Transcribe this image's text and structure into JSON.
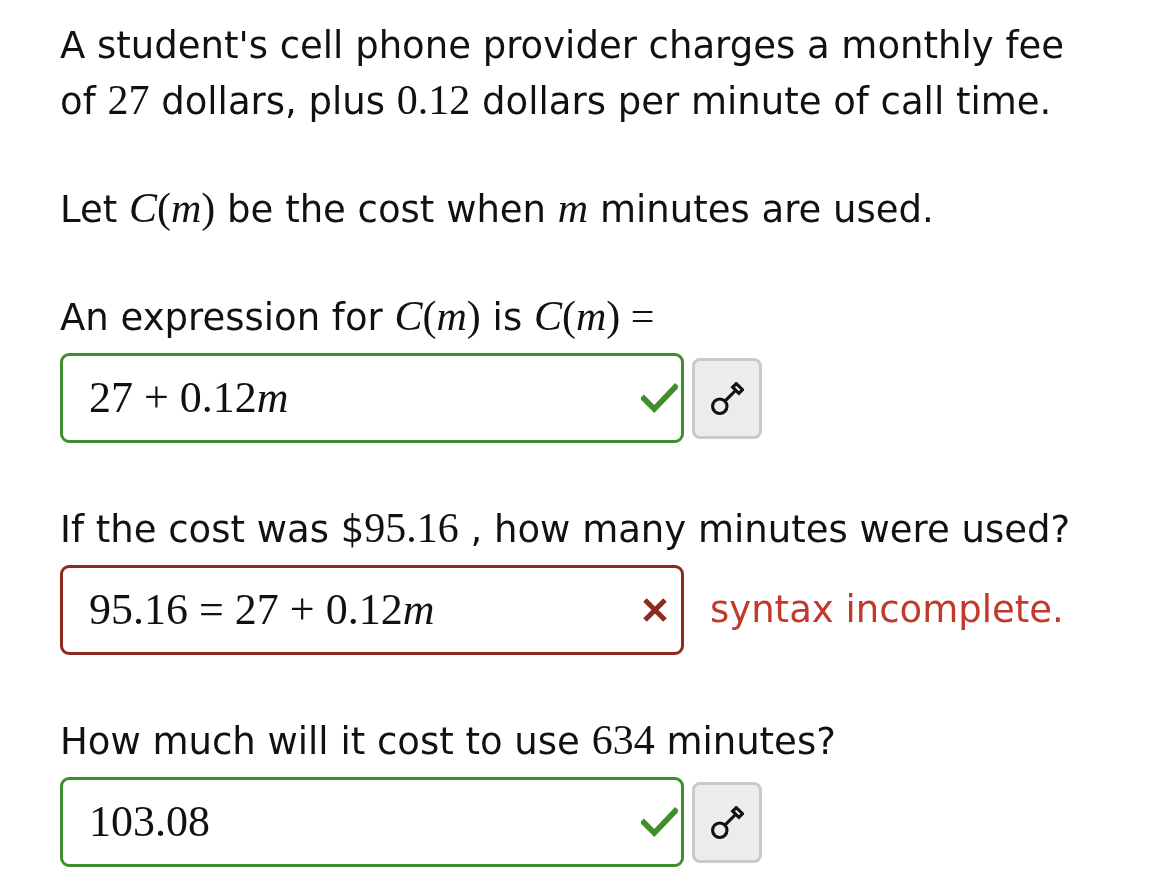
{
  "statement": [
    {
      "parts": [
        {
          "kind": "text",
          "text": "A student's cell phone provider charges a monthly fee of "
        },
        {
          "kind": "math",
          "text": "27"
        },
        {
          "kind": "text",
          "text": " dollars, plus "
        },
        {
          "kind": "math",
          "text": "0.12"
        },
        {
          "kind": "text",
          "text": " dollars per minute of call time."
        }
      ]
    },
    {
      "parts": [
        {
          "kind": "text",
          "text": "Let "
        },
        {
          "kind": "math",
          "text": "*C*(*m*)"
        },
        {
          "kind": "text",
          "text": " be the cost when "
        },
        {
          "kind": "math",
          "text": "*m*"
        },
        {
          "kind": "text",
          "text": " minutes are used."
        }
      ]
    }
  ],
  "questions": [
    {
      "prompt": [
        {
          "kind": "text",
          "text": "An expression for "
        },
        {
          "kind": "math",
          "text": "*C*(*m*)"
        },
        {
          "kind": "text",
          "text": " is "
        },
        {
          "kind": "math",
          "text": "*C*(*m*) ="
        }
      ],
      "answer": {
        "value": [
          {
            "kind": "math",
            "text": "27 + 0.12"
          },
          {
            "kind": "math",
            "text": "*m*"
          }
        ],
        "correct": true
      }
    },
    {
      "prompt": [
        {
          "kind": "text",
          "text": "If the cost was $"
        },
        {
          "kind": "math",
          "text": "95.16"
        },
        {
          "kind": "text",
          "text": " , how many minutes were used?"
        }
      ],
      "answer": {
        "value": [
          {
            "kind": "math",
            "text": "95.16 = 27 + 0.12"
          },
          {
            "kind": "math",
            "text": "*m*"
          }
        ],
        "correct": false,
        "feedback": "syntax incomplete."
      }
    },
    {
      "prompt": [
        {
          "kind": "text",
          "text": "How much will it cost to use "
        },
        {
          "kind": "math",
          "text": "634"
        },
        {
          "kind": "text",
          "text": " minutes?"
        }
      ],
      "answer": {
        "value": [
          {
            "kind": "math",
            "text": "103.08"
          }
        ],
        "correct": true
      }
    }
  ]
}
